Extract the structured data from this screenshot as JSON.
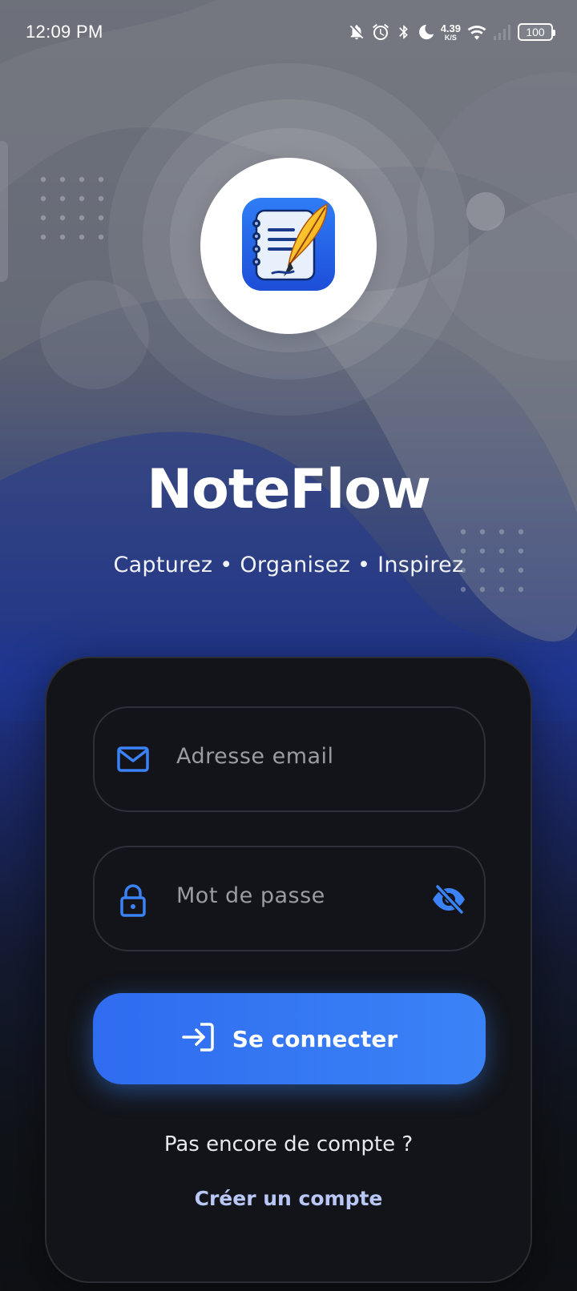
{
  "status_bar": {
    "time": "12:09 PM",
    "net_speed_value": "4.39",
    "net_speed_unit": "K/S",
    "battery": "100",
    "icons": [
      "bell-off-icon",
      "alarm-icon",
      "bluetooth-icon",
      "moon-icon",
      "wifi-icon",
      "signal-icon",
      "battery-icon"
    ]
  },
  "app": {
    "name": "NoteFlow",
    "tagline": "Capturez • Organisez • Inspirez",
    "logo_icon": "notebook-quill-icon"
  },
  "form": {
    "email_placeholder": "Adresse email",
    "password_placeholder": "Mot de passe",
    "login_label": "Se connecter",
    "no_account_text": "Pas encore de compte ?",
    "create_account_label": "Créer un compte"
  },
  "colors": {
    "accent": "#3b82f6",
    "card_bg": "#121419",
    "link": "#b9c7f7"
  }
}
